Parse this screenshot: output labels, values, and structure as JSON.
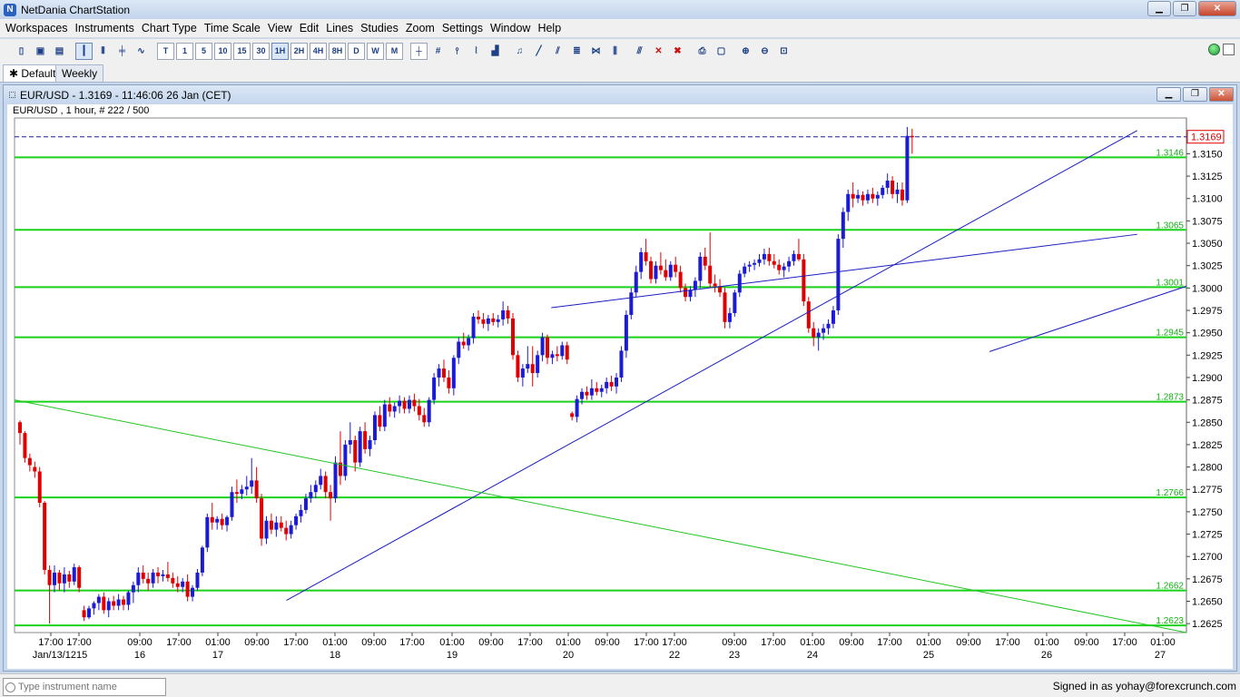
{
  "app": {
    "title": "NetDania ChartStation",
    "window_buttons": [
      "▁",
      "❐",
      "✕"
    ]
  },
  "menu": [
    "Workspaces",
    "Instruments",
    "Chart Type",
    "Time Scale",
    "View",
    "Edit",
    "Lines",
    "Studies",
    "Zoom",
    "Settings",
    "Window",
    "Help"
  ],
  "toolbar": {
    "timeframes": [
      "T",
      "1",
      "5",
      "10",
      "15",
      "30",
      "1H",
      "2H",
      "4H",
      "8H",
      "D",
      "W",
      "M"
    ],
    "active_timeframe": "1H"
  },
  "tabs": [
    {
      "label": "Default",
      "selected": true
    },
    {
      "label": "Weekly",
      "selected": false
    }
  ],
  "chart_window": {
    "title": "EUR/USD - 1.3169 - 11:46:06  26 Jan (CET)",
    "info": "EUR/USD , 1 hour, # 222 / 500"
  },
  "chart_data": {
    "type": "candlestick",
    "instrument": "EUR/USD",
    "timeframe": "1 hour",
    "current_price": "1.3169",
    "ylim": [
      1.2615,
      1.319
    ],
    "y_ticks": [
      "1.3150",
      "1.3125",
      "1.3100",
      "1.3075",
      "1.3050",
      "1.3025",
      "1.3000",
      "1.2975",
      "1.2950",
      "1.2925",
      "1.2900",
      "1.2875",
      "1.2850",
      "1.2825",
      "1.2800",
      "1.2775",
      "1.2750",
      "1.2725",
      "1.2700",
      "1.2675",
      "1.2650",
      "1.2625"
    ],
    "horizontal_levels": [
      "1.3146",
      "1.3065",
      "1.3001",
      "1.2945",
      "1.2873",
      "1.2766",
      "1.2662",
      "1.2623"
    ],
    "x_time_labels": [
      "17:00",
      "17:00",
      "09:00",
      "17:00",
      "01:00",
      "09:00",
      "17:00",
      "01:00",
      "09:00",
      "17:00",
      "01:00",
      "09:00",
      "17:00",
      "01:00",
      "09:00",
      "17:00",
      "17:00",
      "09:00",
      "17:00",
      "01:00",
      "09:00",
      "17:00",
      "01:00",
      "09:00",
      "17:00",
      "01:00",
      "09:00",
      "17:00",
      "01:00"
    ],
    "x_date_labels": [
      "Jan/13/1215",
      "16",
      "17",
      "18",
      "19",
      "20",
      "22",
      "23",
      "24",
      "25",
      "26",
      "27"
    ],
    "trendlines": [
      {
        "color": "#1b1bc4",
        "from": [
          0.232,
          1.2651
        ],
        "to": [
          0.958,
          1.3176
        ]
      },
      {
        "color": "#1b1bc4",
        "from": [
          0.458,
          1.2978
        ],
        "to": [
          0.958,
          1.306
        ]
      },
      {
        "color": "#1b1bc4",
        "from": [
          0.832,
          1.2929
        ],
        "to": [
          1.0,
          1.3002
        ]
      },
      {
        "color": "#22c422",
        "from": [
          0.0,
          1.2875
        ],
        "to": [
          1.0,
          1.2615
        ]
      }
    ],
    "colors": {
      "up": "#1b1bd6",
      "down": "#e00000",
      "level": "#19d219",
      "level_label": "#10b010",
      "current": "#e00000",
      "dash": "#1a1aa0"
    },
    "candles": [
      [
        1.285,
        1.2852,
        1.2825,
        1.2838
      ],
      [
        1.2838,
        1.284,
        1.2805,
        1.281
      ],
      [
        1.281,
        1.2815,
        1.2795,
        1.2802
      ],
      [
        1.28,
        1.2806,
        1.2788,
        1.2795
      ],
      [
        1.2795,
        1.28,
        1.2755,
        1.276
      ],
      [
        1.276,
        1.2762,
        1.268,
        1.2685
      ],
      [
        1.2685,
        1.269,
        1.2625,
        1.2668
      ],
      [
        1.2668,
        1.269,
        1.266,
        1.2682
      ],
      [
        1.2682,
        1.2685,
        1.2662,
        1.267
      ],
      [
        1.267,
        1.2688,
        1.266,
        1.268
      ],
      [
        1.268,
        1.2684,
        1.2665,
        1.2672
      ],
      [
        1.2672,
        1.2692,
        1.2668,
        1.2688
      ],
      [
        1.2688,
        1.269,
        1.266,
        1.2665
      ],
      [
        1.264,
        1.2645,
        1.2628,
        1.2632
      ],
      [
        1.2632,
        1.2645,
        1.263,
        1.2642
      ],
      [
        1.2642,
        1.265,
        1.2635,
        1.2648
      ],
      [
        1.2648,
        1.2658,
        1.264,
        1.2655
      ],
      [
        1.2655,
        1.266,
        1.2636,
        1.264
      ],
      [
        1.264,
        1.2654,
        1.2632,
        1.265
      ],
      [
        1.265,
        1.2656,
        1.264,
        1.2645
      ],
      [
        1.2645,
        1.2658,
        1.264,
        1.2652
      ],
      [
        1.2652,
        1.2656,
        1.264,
        1.2646
      ],
      [
        1.2646,
        1.2662,
        1.264,
        1.266
      ],
      [
        1.266,
        1.2672,
        1.2648,
        1.2668
      ],
      [
        1.2668,
        1.2688,
        1.266,
        1.2682
      ],
      [
        1.2682,
        1.269,
        1.267,
        1.2675
      ],
      [
        1.2675,
        1.2682,
        1.2662,
        1.267
      ],
      [
        1.267,
        1.2686,
        1.2665,
        1.2682
      ],
      [
        1.2682,
        1.2688,
        1.267,
        1.2678
      ],
      [
        1.2678,
        1.2685,
        1.2672,
        1.268
      ],
      [
        1.268,
        1.2694,
        1.2672,
        1.2676
      ],
      [
        1.2676,
        1.2682,
        1.2665,
        1.267
      ],
      [
        1.267,
        1.2678,
        1.266,
        1.2666
      ],
      [
        1.2666,
        1.2676,
        1.266,
        1.2672
      ],
      [
        1.2672,
        1.268,
        1.265,
        1.2655
      ],
      [
        1.2655,
        1.2668,
        1.265,
        1.2665
      ],
      [
        1.2665,
        1.2686,
        1.2662,
        1.2682
      ],
      [
        1.2682,
        1.2712,
        1.2678,
        1.271
      ],
      [
        1.271,
        1.2748,
        1.2705,
        1.2744
      ],
      [
        1.2744,
        1.276,
        1.273,
        1.2738
      ],
      [
        1.2738,
        1.2745,
        1.273,
        1.2742
      ],
      [
        1.2742,
        1.2748,
        1.273,
        1.2735
      ],
      [
        1.2735,
        1.2746,
        1.2728,
        1.2744
      ],
      [
        1.2744,
        1.2778,
        1.274,
        1.2772
      ],
      [
        1.2772,
        1.2786,
        1.276,
        1.277
      ],
      [
        1.277,
        1.278,
        1.2764,
        1.2775
      ],
      [
        1.2775,
        1.279,
        1.2768,
        1.2778
      ],
      [
        1.2778,
        1.281,
        1.277,
        1.2785
      ],
      [
        1.2785,
        1.28,
        1.276,
        1.2765
      ],
      [
        1.2765,
        1.277,
        1.2712,
        1.272
      ],
      [
        1.272,
        1.2745,
        1.2714,
        1.274
      ],
      [
        1.274,
        1.2748,
        1.2725,
        1.273
      ],
      [
        1.273,
        1.2745,
        1.2722,
        1.2738
      ],
      [
        1.2738,
        1.2745,
        1.2728,
        1.2732
      ],
      [
        1.2732,
        1.274,
        1.2718,
        1.2725
      ],
      [
        1.2725,
        1.274,
        1.272,
        1.2735
      ],
      [
        1.2735,
        1.2748,
        1.273,
        1.2745
      ],
      [
        1.2745,
        1.2758,
        1.2738,
        1.2752
      ],
      [
        1.2752,
        1.277,
        1.2748,
        1.2765
      ],
      [
        1.2765,
        1.278,
        1.276,
        1.2772
      ],
      [
        1.2772,
        1.2785,
        1.2765,
        1.278
      ],
      [
        1.278,
        1.2798,
        1.2775,
        1.279
      ],
      [
        1.279,
        1.2795,
        1.2765,
        1.2772
      ],
      [
        1.2772,
        1.278,
        1.274,
        1.2765
      ],
      [
        1.2765,
        1.2812,
        1.276,
        1.2805
      ],
      [
        1.2805,
        1.284,
        1.278,
        1.279
      ],
      [
        1.279,
        1.283,
        1.2785,
        1.2825
      ],
      [
        1.2825,
        1.285,
        1.2815,
        1.283
      ],
      [
        1.283,
        1.2835,
        1.2795,
        1.2805
      ],
      [
        1.2805,
        1.2845,
        1.28,
        1.284
      ],
      [
        1.284,
        1.285,
        1.2815,
        1.282
      ],
      [
        1.282,
        1.2835,
        1.2812,
        1.283
      ],
      [
        1.283,
        1.2862,
        1.2825,
        1.2858
      ],
      [
        1.2858,
        1.2868,
        1.284,
        1.2845
      ],
      [
        1.2845,
        1.2875,
        1.284,
        1.287
      ],
      [
        1.287,
        1.2878,
        1.2856,
        1.2862
      ],
      [
        1.2862,
        1.2872,
        1.2855,
        1.2868
      ],
      [
        1.2868,
        1.288,
        1.286,
        1.2874
      ],
      [
        1.2874,
        1.2878,
        1.286,
        1.2865
      ],
      [
        1.2865,
        1.288,
        1.286,
        1.2875
      ],
      [
        1.2875,
        1.2882,
        1.2862,
        1.2868
      ],
      [
        1.2868,
        1.2876,
        1.2852,
        1.2858
      ],
      [
        1.2858,
        1.2866,
        1.2845,
        1.285
      ],
      [
        1.285,
        1.2878,
        1.2845,
        1.2875
      ],
      [
        1.2875,
        1.2905,
        1.287,
        1.29
      ],
      [
        1.29,
        1.2915,
        1.289,
        1.291
      ],
      [
        1.291,
        1.292,
        1.2895,
        1.29
      ],
      [
        1.29,
        1.2908,
        1.2882,
        1.2888
      ],
      [
        1.2888,
        1.2925,
        1.288,
        1.2922
      ],
      [
        1.2922,
        1.2945,
        1.2915,
        1.294
      ],
      [
        1.294,
        1.295,
        1.2932,
        1.2936
      ],
      [
        1.2936,
        1.2948,
        1.293,
        1.2944
      ],
      [
        1.2944,
        1.2972,
        1.2938,
        1.2968
      ],
      [
        1.2968,
        1.2975,
        1.296,
        1.2965
      ],
      [
        1.2965,
        1.2972,
        1.2955,
        1.296
      ],
      [
        1.296,
        1.297,
        1.2952,
        1.2966
      ],
      [
        1.2966,
        1.2972,
        1.2958,
        1.2962
      ],
      [
        1.2962,
        1.297,
        1.2956,
        1.2965
      ],
      [
        1.2965,
        1.2985,
        1.2958,
        1.2975
      ],
      [
        1.2975,
        1.298,
        1.296,
        1.2966
      ],
      [
        1.2966,
        1.2972,
        1.292,
        1.2925
      ],
      [
        1.2925,
        1.293,
        1.2895,
        1.29
      ],
      [
        1.29,
        1.2915,
        1.289,
        1.291
      ],
      [
        1.291,
        1.2935,
        1.2905,
        1.2915
      ],
      [
        1.2915,
        1.2935,
        1.289,
        1.2905
      ],
      [
        1.2905,
        1.293,
        1.29,
        1.2925
      ],
      [
        1.2925,
        1.295,
        1.2918,
        1.2945
      ],
      [
        1.2945,
        1.2948,
        1.2915,
        1.2922
      ],
      [
        1.2922,
        1.293,
        1.2915,
        1.2926
      ],
      [
        1.2926,
        1.2935,
        1.2918,
        1.2924
      ],
      [
        1.2924,
        1.294,
        1.292,
        1.2936
      ],
      [
        1.2936,
        1.294,
        1.2915,
        1.292
      ],
      [
        1.286,
        1.2862,
        1.2852,
        1.2856
      ],
      [
        1.2856,
        1.288,
        1.285,
        1.2876
      ],
      [
        1.2876,
        1.2888,
        1.287,
        1.2884
      ],
      [
        1.2884,
        1.289,
        1.2875,
        1.288
      ],
      [
        1.288,
        1.2898,
        1.2875,
        1.2888
      ],
      [
        1.2888,
        1.2895,
        1.288,
        1.2884
      ],
      [
        1.2884,
        1.2892,
        1.2878,
        1.2888
      ],
      [
        1.2888,
        1.29,
        1.2882,
        1.2895
      ],
      [
        1.2895,
        1.2902,
        1.2885,
        1.289
      ],
      [
        1.289,
        1.2905,
        1.2882,
        1.29
      ],
      [
        1.29,
        1.2935,
        1.2895,
        1.293
      ],
      [
        1.293,
        1.2975,
        1.2922,
        1.297
      ],
      [
        1.297,
        1.3,
        1.2965,
        1.2995
      ],
      [
        1.2995,
        1.3025,
        1.299,
        1.3018
      ],
      [
        1.3018,
        1.3045,
        1.301,
        1.304
      ],
      [
        1.304,
        1.3055,
        1.3025,
        1.303
      ],
      [
        1.303,
        1.3035,
        1.3005,
        1.301
      ],
      [
        1.301,
        1.303,
        1.3005,
        1.3025
      ],
      [
        1.3025,
        1.304,
        1.3015,
        1.302
      ],
      [
        1.302,
        1.3032,
        1.3008,
        1.3012
      ],
      [
        1.3012,
        1.303,
        1.3008,
        1.3026
      ],
      [
        1.3026,
        1.3035,
        1.3012,
        1.3018
      ],
      [
        1.3018,
        1.3025,
        1.2995,
        1.3
      ],
      [
        1.3,
        1.3005,
        1.2985,
        1.299
      ],
      [
        1.299,
        1.3002,
        1.2985,
        1.2998
      ],
      [
        1.2998,
        1.3012,
        1.299,
        1.3008
      ],
      [
        1.3008,
        1.304,
        1.3,
        1.3035
      ],
      [
        1.3035,
        1.3045,
        1.302,
        1.3025
      ],
      [
        1.3025,
        1.3062,
        1.3,
        1.3005
      ],
      [
        1.3005,
        1.3015,
        1.2995,
        1.3002
      ],
      [
        1.3002,
        1.301,
        1.299,
        1.2995
      ],
      [
        1.2995,
        1.3,
        1.2955,
        1.2962
      ],
      [
        1.2962,
        1.2978,
        1.2955,
        1.2972
      ],
      [
        1.2972,
        1.2998,
        1.2968,
        1.2995
      ],
      [
        1.2995,
        1.302,
        1.299,
        1.3016
      ],
      [
        1.3016,
        1.3028,
        1.3012,
        1.3024
      ],
      [
        1.3024,
        1.303,
        1.3018,
        1.3026
      ],
      [
        1.3026,
        1.3032,
        1.302,
        1.3028
      ],
      [
        1.3028,
        1.3038,
        1.3024,
        1.3032
      ],
      [
        1.3032,
        1.3044,
        1.3026,
        1.3038
      ],
      [
        1.3038,
        1.3045,
        1.3025,
        1.303
      ],
      [
        1.303,
        1.3038,
        1.3022,
        1.3026
      ],
      [
        1.3026,
        1.3032,
        1.3015,
        1.302
      ],
      [
        1.302,
        1.3028,
        1.3012,
        1.3024
      ],
      [
        1.3024,
        1.3035,
        1.3018,
        1.303
      ],
      [
        1.303,
        1.3042,
        1.3025,
        1.3038
      ],
      [
        1.3038,
        1.3055,
        1.303,
        1.3032
      ],
      [
        1.3032,
        1.3038,
        1.298,
        1.2985
      ],
      [
        1.2985,
        1.299,
        1.295,
        1.2955
      ],
      [
        1.2955,
        1.2962,
        1.2935,
        1.2945
      ],
      [
        1.2945,
        1.2955,
        1.293,
        1.295
      ],
      [
        1.295,
        1.296,
        1.2942,
        1.2955
      ],
      [
        1.2955,
        1.2965,
        1.2948,
        1.296
      ],
      [
        1.296,
        1.298,
        1.2955,
        1.2975
      ],
      [
        1.2975,
        1.306,
        1.297,
        1.3055
      ],
      [
        1.3055,
        1.309,
        1.3045,
        1.3085
      ],
      [
        1.3085,
        1.311,
        1.3075,
        1.3105
      ],
      [
        1.3105,
        1.3118,
        1.309,
        1.31
      ],
      [
        1.31,
        1.311,
        1.3095,
        1.3104
      ],
      [
        1.3104,
        1.3108,
        1.3092,
        1.3098
      ],
      [
        1.3098,
        1.311,
        1.3094,
        1.3105
      ],
      [
        1.3105,
        1.3112,
        1.3095,
        1.31
      ],
      [
        1.31,
        1.3108,
        1.3092,
        1.3104
      ],
      [
        1.3104,
        1.3115,
        1.31,
        1.3112
      ],
      [
        1.3112,
        1.3128,
        1.3105,
        1.312
      ],
      [
        1.312,
        1.3125,
        1.31,
        1.3105
      ],
      [
        1.3105,
        1.3118,
        1.3095,
        1.311
      ],
      [
        1.311,
        1.3118,
        1.3092,
        1.3098
      ],
      [
        1.3098,
        1.318,
        1.3095,
        1.317
      ],
      [
        1.317,
        1.3178,
        1.315,
        1.3169
      ]
    ]
  },
  "bottom": {
    "search_placeholder": "Type instrument name",
    "signed_in": "Signed in as yohay@forexcrunch.com"
  }
}
